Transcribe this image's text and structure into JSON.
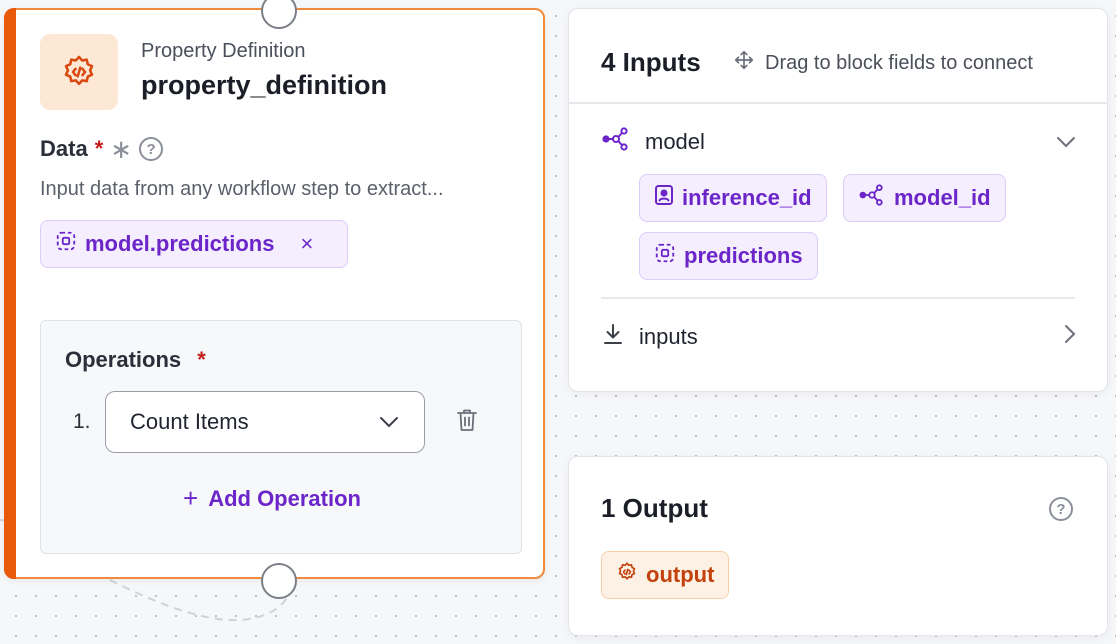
{
  "block": {
    "icon": "code-gear-icon",
    "type_label": "Property Definition",
    "name": "property_definition",
    "data_field": {
      "label": "Data",
      "required_mark": "*",
      "secondary_mark": "∗",
      "help": "?",
      "description": "Input data from any workflow step to extract...",
      "selected_value": "model.predictions",
      "remove_glyph": "×"
    },
    "operations": {
      "label": "Operations",
      "required_mark": "*",
      "items": [
        {
          "index": "1.",
          "value": "Count Items"
        }
      ],
      "add_label": "Add Operation",
      "add_glyph": "+"
    }
  },
  "inputs_panel": {
    "title": "4 Inputs",
    "hint": "Drag to block fields to connect",
    "groups": [
      {
        "label": "model",
        "icon": "model-graph-icon",
        "expanded": true,
        "fields": [
          {
            "label": "inference_id",
            "icon": "id-badge-icon"
          },
          {
            "label": "model_id",
            "icon": "model-graph-icon"
          },
          {
            "label": "predictions",
            "icon": "dashed-box-icon"
          }
        ]
      },
      {
        "label": "inputs",
        "icon": "download-arrow-icon",
        "expanded": false
      }
    ]
  },
  "output_panel": {
    "title": "1 Output",
    "help": "?",
    "outputs": [
      {
        "label": "output",
        "icon": "code-gear-icon"
      }
    ]
  },
  "colors": {
    "accent_orange": "#e8590c",
    "chip_purple": "#6b25c9",
    "required_red": "#c41d1d"
  }
}
